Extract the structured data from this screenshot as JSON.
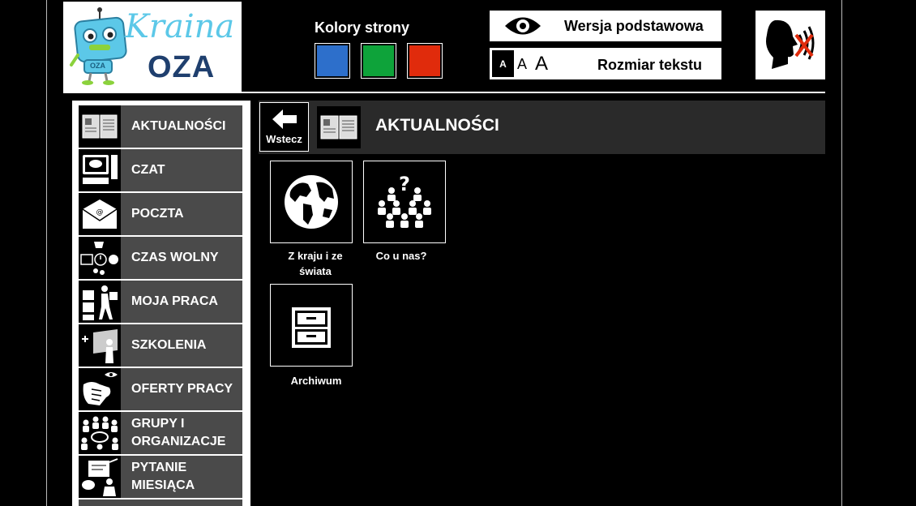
{
  "logo": {
    "word1": "Kraina",
    "word2": "OZA",
    "robot_badge": "OZA"
  },
  "colors": {
    "title": "Kolory strony",
    "swatches": [
      {
        "name": "blue",
        "hex": "#2d6fcb"
      },
      {
        "name": "green",
        "hex": "#0ea33a"
      },
      {
        "name": "red",
        "hex": "#e02b0c"
      }
    ]
  },
  "version_button": {
    "label": "Wersja podstawowa",
    "icon": "eye-icon"
  },
  "text_size": {
    "label": "Rozmiar tekstu",
    "sizes": [
      "A",
      "A",
      "A"
    ]
  },
  "speech_toggle": {
    "icon": "speech-off-icon"
  },
  "menu": {
    "items": [
      {
        "id": "aktualnosci",
        "label": "AKTUALNOŚCI",
        "icon": "newspaper-icon"
      },
      {
        "id": "czat",
        "label": "CZAT",
        "icon": "computer-chat-icon"
      },
      {
        "id": "poczta",
        "label": "POCZTA",
        "icon": "envelope-icon"
      },
      {
        "id": "czas-wolny",
        "label": "CZAS WOLNY",
        "icon": "leisure-icon"
      },
      {
        "id": "moja-praca",
        "label": "MOJA PRACA",
        "icon": "worker-boxes-icon"
      },
      {
        "id": "szkolenia",
        "label": "SZKOLENIA",
        "icon": "presentation-icon"
      },
      {
        "id": "oferty-pracy",
        "label": "OFERTY PRACY",
        "icon": "handshake-icon"
      },
      {
        "id": "grupy",
        "label": "GRUPY I ORGANIZACJE",
        "icon": "group-circle-icon"
      },
      {
        "id": "pytanie",
        "label": "PYTANIE MIESIĄCA",
        "icon": "question-board-icon"
      }
    ]
  },
  "header": {
    "back_label": "Wstecz",
    "title": "AKTUALNOŚCI",
    "icon": "newspaper-icon"
  },
  "tiles": [
    {
      "id": "z-kraju",
      "label": "Z kraju i ze świata",
      "icon": "globe-icon"
    },
    {
      "id": "co-u-nas",
      "label": "Co u nas?",
      "icon": "people-question-icon"
    },
    {
      "id": "archiwum",
      "label": "Archiwum",
      "icon": "cabinet-icon"
    }
  ]
}
